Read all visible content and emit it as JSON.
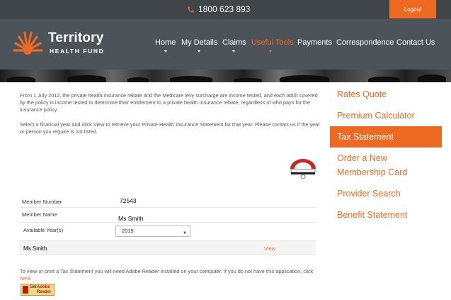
{
  "topbar": {
    "phone": "1800 623 893",
    "logout_label": "Logout"
  },
  "header": {
    "logo_name": "Territory",
    "logo_sub": "HEALTH FUND",
    "nav": [
      {
        "label": "Home",
        "has_caret": true
      },
      {
        "label": "My Details",
        "has_caret": true
      },
      {
        "label": "Claims",
        "has_caret": true
      },
      {
        "label": "Useful Tools",
        "has_caret": true,
        "active": true
      },
      {
        "label": "Payments",
        "has_caret": false
      },
      {
        "label": "Correspondence",
        "has_caret": false
      },
      {
        "label": "Contact Us",
        "has_caret": false
      }
    ]
  },
  "main": {
    "intro": "From 1 July 2012, the private health insurance rebate and the Medicare levy surcharge are income tested, and each adult covered by the policy is income tested to determine their entitlement to a private health insurance rebate, regardless of who pays for the insurance policy.",
    "instructions": "Select a financial year and click View to retrieve your Private Health Insurance Statement for that year.  Please contact us if the year or person you require is not listed.",
    "form": {
      "member_number_label": "Member Number",
      "member_number_value": "72543",
      "member_name_label": "Member Name",
      "member_name_value": "Ms Smith",
      "years_label": "Available Year(s)",
      "year_selected": "2019",
      "statement_person": "Ms Smith",
      "view_label": "View"
    },
    "reader_note": "To view or print a Tax Statement you will need Adobe Reader installed on your computer. If you do not have this application, click ",
    "reader_link": "here",
    "reader_note_end": ".",
    "adobe_badge": {
      "get": "Get",
      "adobe": "Adobe",
      "reader": "Reader"
    }
  },
  "sidebar": {
    "items": [
      {
        "label": "Rates Quote",
        "active": false
      },
      {
        "label": "Premium Calculator",
        "active": false
      },
      {
        "label": "Tax Statement",
        "active": true
      },
      {
        "label": "Order a New Membership Card",
        "active": false
      },
      {
        "label": "Provider Search",
        "active": false
      },
      {
        "label": "Benefit Statement",
        "active": false
      }
    ]
  },
  "colors": {
    "accent": "#ee6a23",
    "header_bg": "#4d5459",
    "topbar_bg": "#3f4549"
  }
}
